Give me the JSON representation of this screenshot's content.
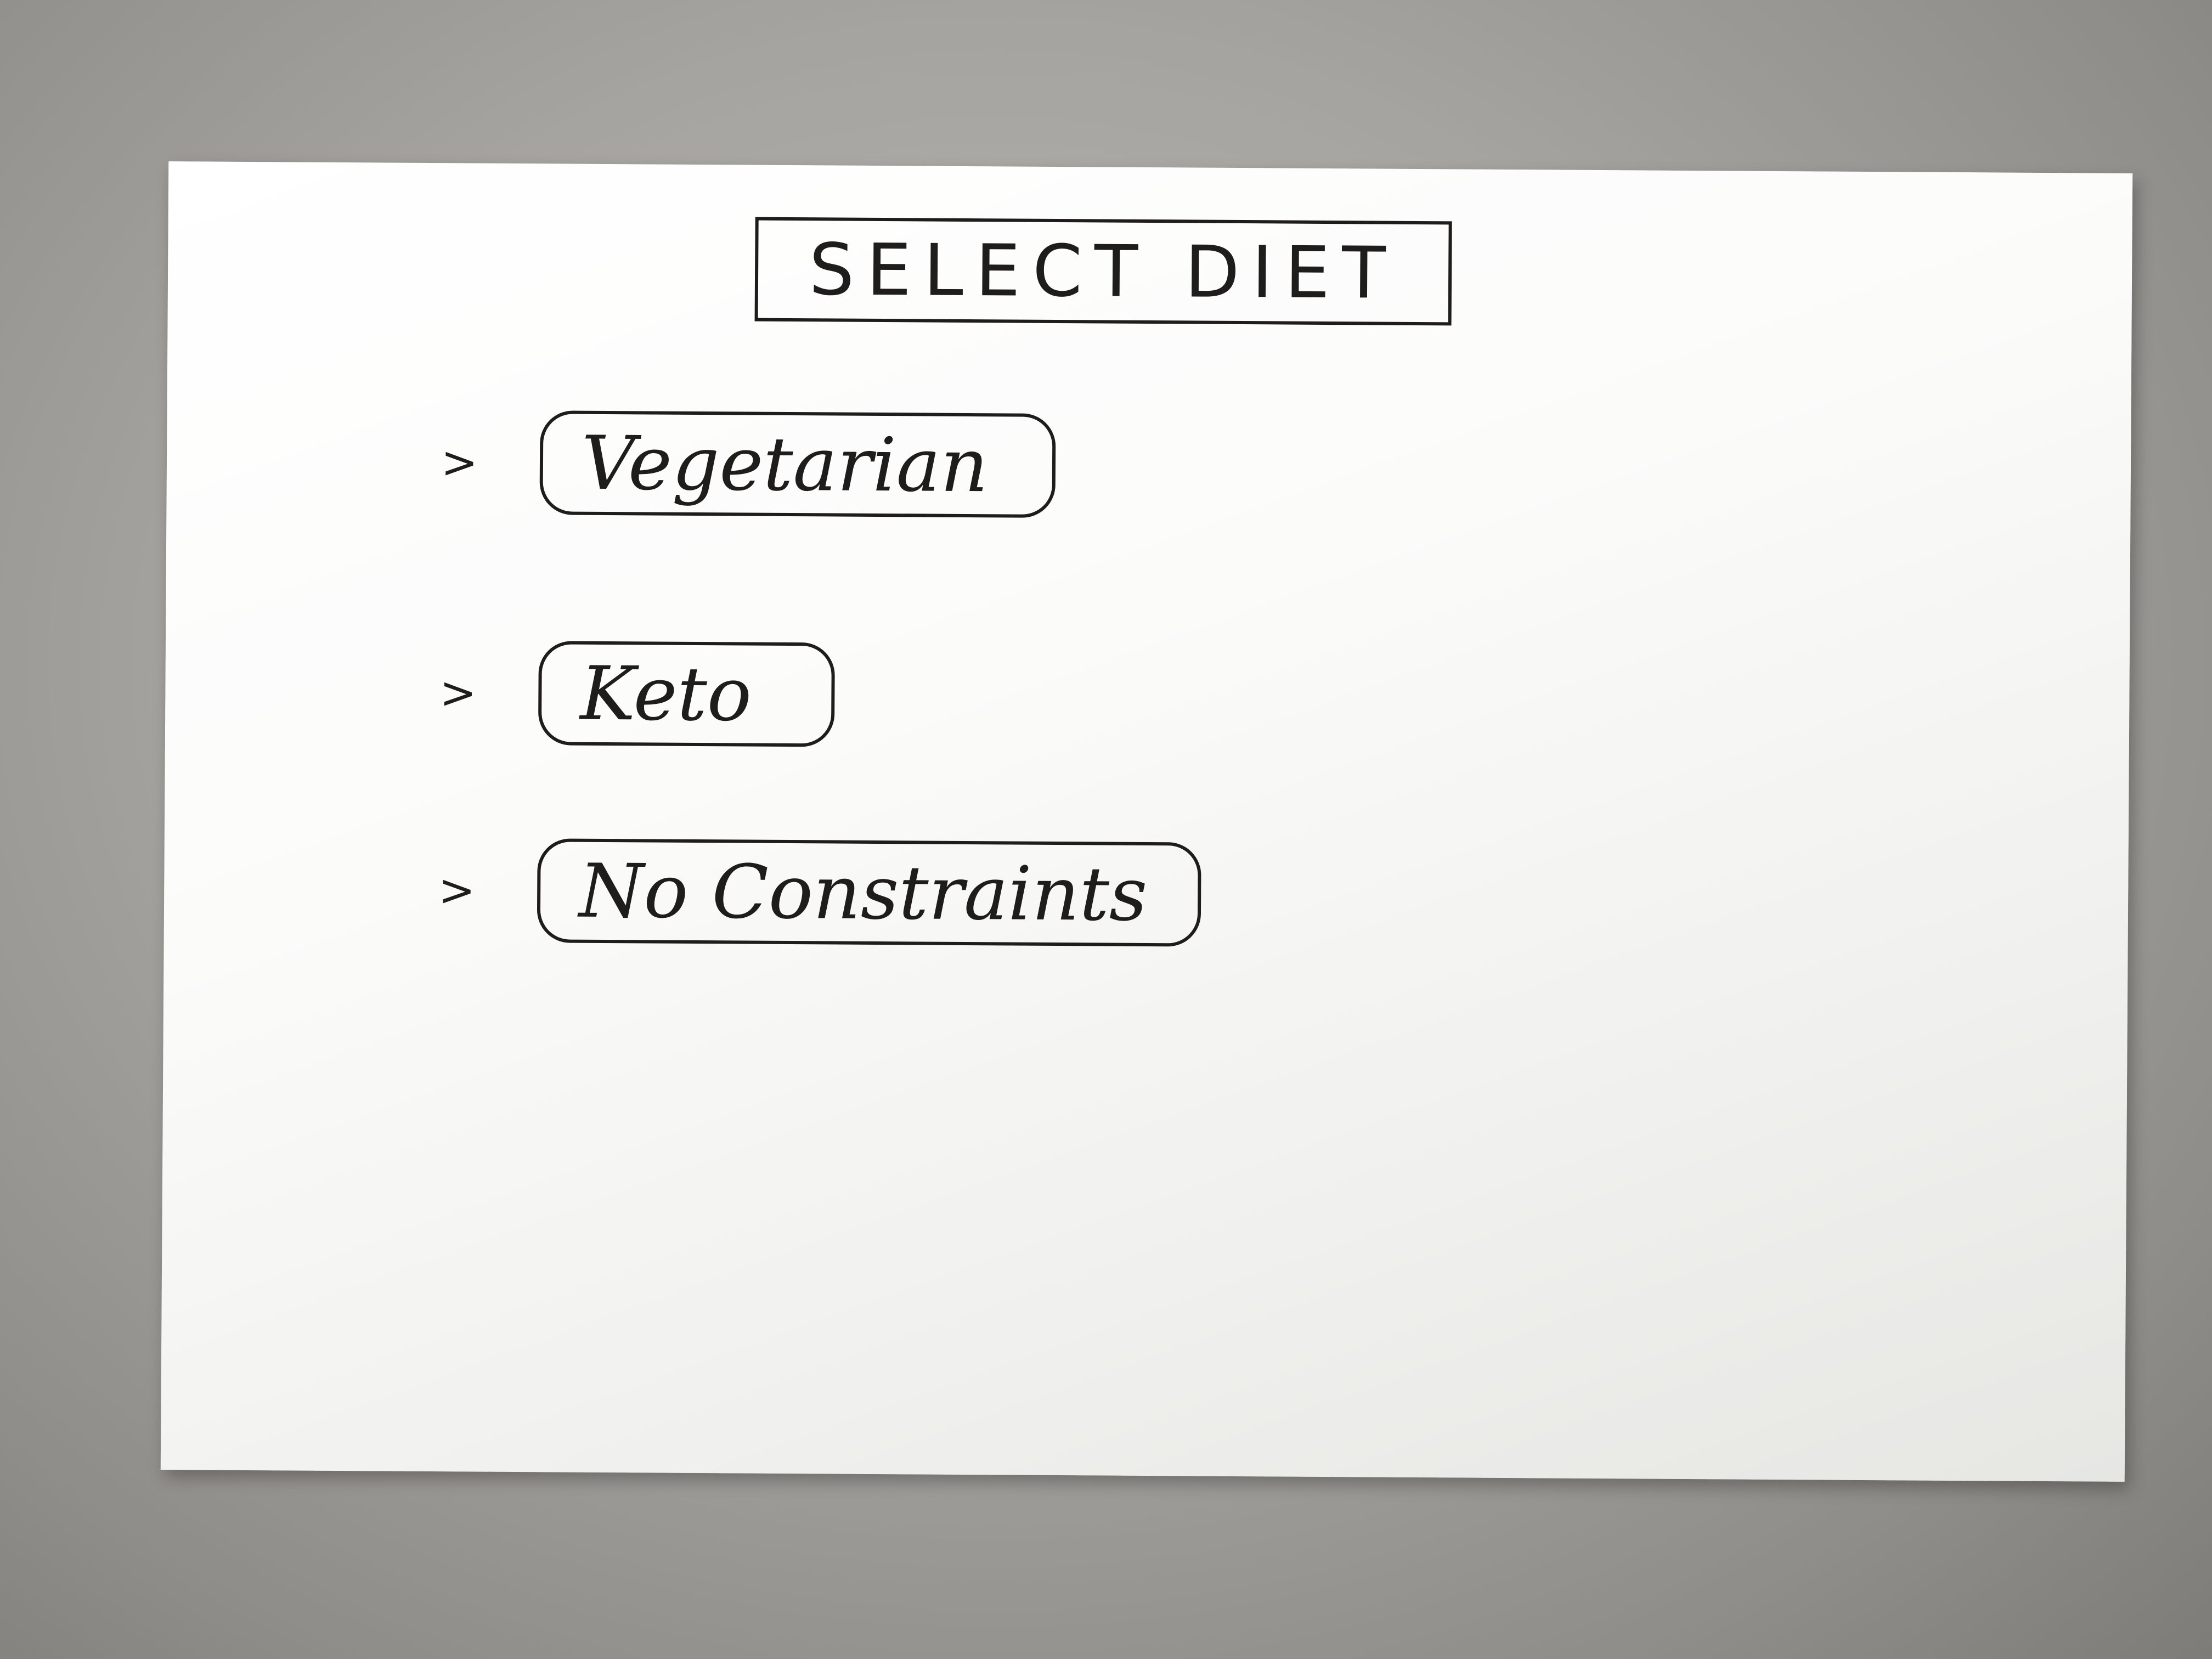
{
  "screen": {
    "title": "SELECT DIET"
  },
  "options": [
    {
      "marker": ">",
      "label": "Vegetarian"
    },
    {
      "marker": ">",
      "label": "Keto"
    },
    {
      "marker": ">",
      "label": "No Constraints"
    }
  ],
  "colors": {
    "ink": "#1f1d1b",
    "card": "#ffffff",
    "background": "#a6a4a0"
  }
}
